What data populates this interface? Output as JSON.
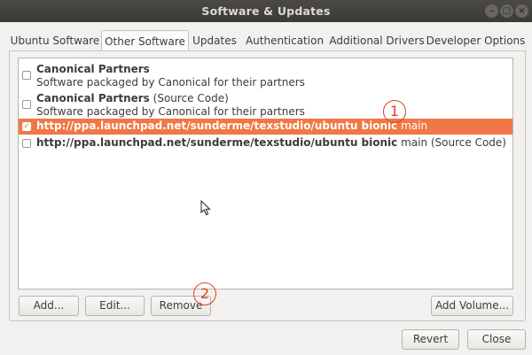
{
  "window": {
    "title": "Software & Updates"
  },
  "tabs": [
    {
      "label": "Ubuntu Software"
    },
    {
      "label": "Other Software",
      "active": true
    },
    {
      "label": "Updates"
    },
    {
      "label": "Authentication"
    },
    {
      "label": "Additional Drivers"
    },
    {
      "label": "Developer Options"
    }
  ],
  "sources": [
    {
      "bold": "Canonical Partners",
      "rest": "",
      "sub": "Software packaged by Canonical for their partners",
      "checked": false
    },
    {
      "bold": "Canonical Partners",
      "rest": " (Source Code)",
      "sub": "Software packaged by Canonical for their partners",
      "checked": false
    },
    {
      "bold": "http://ppa.launchpad.net/sunderme/texstudio/ubuntu bionic",
      "rest": " main",
      "checked": true,
      "selected": true
    },
    {
      "bold": "http://ppa.launchpad.net/sunderme/texstudio/ubuntu bionic",
      "rest": " main (Source Code)",
      "checked": false
    }
  ],
  "buttons": {
    "add": "Add...",
    "edit": "Edit...",
    "remove": "Remove",
    "add_volume": "Add Volume...",
    "revert": "Revert",
    "close": "Close"
  },
  "annotations": [
    "1",
    "2"
  ],
  "colors": {
    "selection": "#f07746",
    "annotation": "#e0401f",
    "titlebar": "#3b3a37"
  }
}
